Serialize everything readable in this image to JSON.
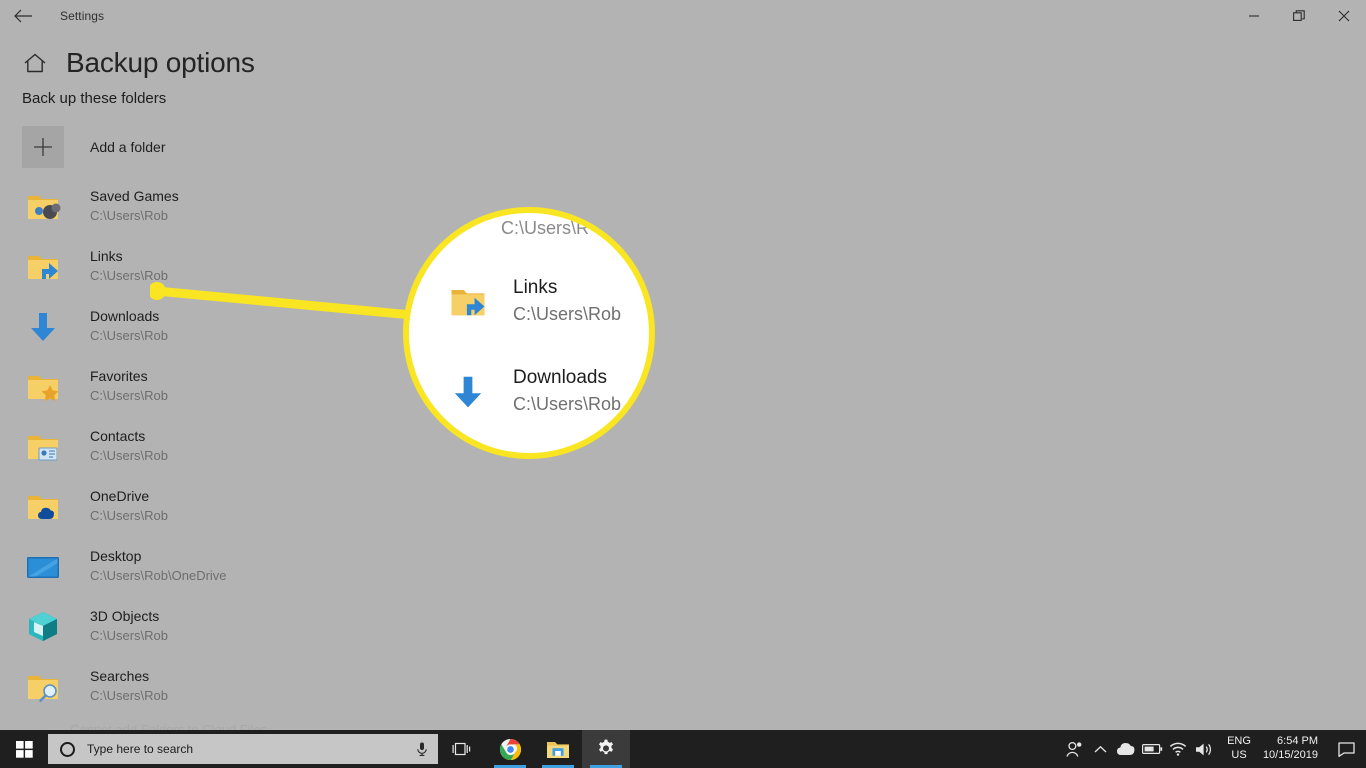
{
  "window": {
    "app_title": "Settings",
    "back_icon": "back-arrow-icon",
    "minimize_label": "—",
    "restore_label": "❐",
    "close_label": "✕"
  },
  "header": {
    "home_icon": "home-icon",
    "page_title": "Backup options",
    "section_title": "Back up these folders"
  },
  "add_folder": {
    "label": "Add a folder",
    "icon": "plus-icon"
  },
  "folders": [
    {
      "name": "Saved Games",
      "path": "C:\\Users\\Rob",
      "icon": "saved-games-folder-icon"
    },
    {
      "name": "Links",
      "path": "C:\\Users\\Rob",
      "icon": "links-folder-icon"
    },
    {
      "name": "Downloads",
      "path": "C:\\Users\\Rob",
      "icon": "downloads-arrow-icon"
    },
    {
      "name": "Favorites",
      "path": "C:\\Users\\Rob",
      "icon": "favorites-folder-icon"
    },
    {
      "name": "Contacts",
      "path": "C:\\Users\\Rob",
      "icon": "contacts-folder-icon"
    },
    {
      "name": "OneDrive",
      "path": "C:\\Users\\Rob",
      "icon": "onedrive-folder-icon"
    },
    {
      "name": "Desktop",
      "path": "C:\\Users\\Rob\\OneDrive",
      "icon": "desktop-monitor-icon"
    },
    {
      "name": "3D Objects",
      "path": "C:\\Users\\Rob",
      "icon": "3d-objects-cube-icon"
    },
    {
      "name": "Searches",
      "path": "C:\\Users\\Rob",
      "icon": "searches-folder-icon"
    }
  ],
  "clipped_row": {
    "text": "Cannot add Folders to Cloud Files"
  },
  "callout": {
    "color": "#f9e521",
    "dot_color": "#f9e521",
    "magnifier_bg": "#ffffff",
    "top_partial_path": "C:\\Users\\R",
    "rows": [
      {
        "name": "Links",
        "path": "C:\\Users\\Rob",
        "icon": "links-folder-icon"
      },
      {
        "name": "Downloads",
        "path": "C:\\Users\\Rob",
        "icon": "downloads-arrow-icon"
      }
    ]
  },
  "taskbar": {
    "start_icon": "windows-start-icon",
    "search_placeholder": "Type here to search",
    "search_icon": "search-circle-icon",
    "mic_icon": "microphone-icon",
    "items": [
      {
        "name": "task-view",
        "icon": "task-view-icon",
        "active": false,
        "running": false
      },
      {
        "name": "google-chrome",
        "icon": "chrome-icon",
        "active": false,
        "running": true
      },
      {
        "name": "file-explorer",
        "icon": "file-explorer-icon",
        "active": false,
        "running": true
      },
      {
        "name": "settings",
        "icon": "gear-icon",
        "active": true,
        "running": true
      }
    ],
    "tray": {
      "people_icon": "people-icon",
      "show_hidden_icon": "chevron-up-icon",
      "onedrive_icon": "onedrive-cloud-icon",
      "battery_icon": "battery-icon",
      "wifi_icon": "wifi-icon",
      "volume_icon": "speaker-icon",
      "language_line1": "ENG",
      "language_line2": "US",
      "time": "6:54 PM",
      "date": "10/15/2019",
      "action_center_icon": "action-center-icon"
    }
  }
}
